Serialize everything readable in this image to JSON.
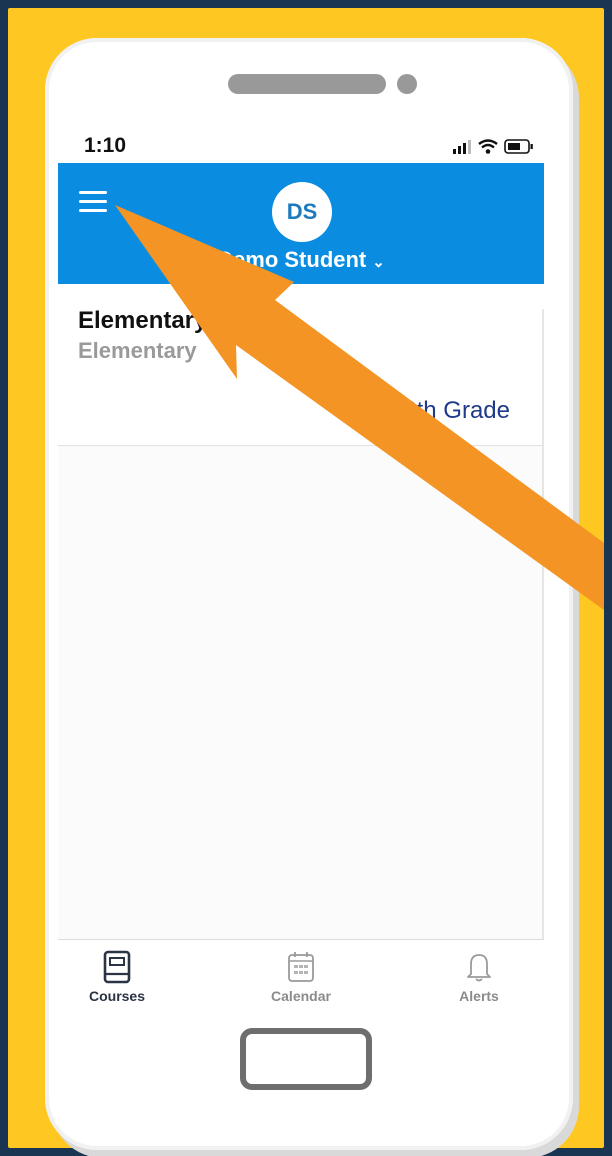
{
  "status_bar": {
    "time": "1:10"
  },
  "header": {
    "avatar_initials": "DS",
    "account_name": "Demo Student",
    "account_chevron": "⌄"
  },
  "course": {
    "title": "Elementary Grade",
    "subtitle": "Elementary",
    "grade": "6th Grade"
  },
  "tabs": [
    {
      "label": "Courses",
      "icon": "book-icon",
      "active": true
    },
    {
      "label": "Calendar",
      "icon": "calendar-icon",
      "active": false
    },
    {
      "label": "Alerts",
      "icon": "bell-icon",
      "active": false
    }
  ],
  "colors": {
    "background": "#1a3552",
    "frame": "#ffc721",
    "header": "#0a8de0",
    "arrow": "#f39424",
    "grade_text": "#1f3a8a"
  }
}
